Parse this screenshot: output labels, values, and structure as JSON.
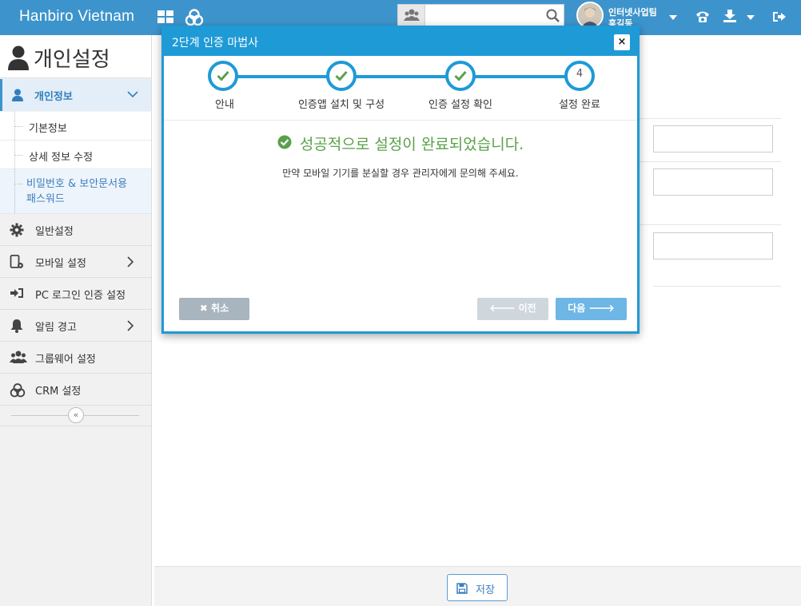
{
  "app": {
    "brand": "Hanbiro Vietnam"
  },
  "header": {
    "search_value": "",
    "user_team": "인터넷사업팀",
    "user_name": "홍길동"
  },
  "sidebar": {
    "page_title": "개인설정",
    "active_section": "개인정보",
    "sub_items": [
      {
        "label": "기본정보"
      },
      {
        "label": "상세 정보 수정"
      },
      {
        "label": "비밀번호 & 보안문서용 패스워드"
      }
    ],
    "nav_items": [
      {
        "label": "일반설정",
        "icon": "gear-icon"
      },
      {
        "label": "모바일 설정",
        "icon": "mobile-settings-icon"
      },
      {
        "label": "PC 로그인 인증 설정",
        "icon": "sign-in-icon"
      },
      {
        "label": "알림 경고",
        "icon": "bell-icon"
      },
      {
        "label": "그룹웨어 설정",
        "icon": "users-icon"
      },
      {
        "label": "CRM 설정",
        "icon": "crm-icon"
      }
    ]
  },
  "modal": {
    "title": "2단계 인증 마법사",
    "close": "×",
    "steps": [
      {
        "label": "안내",
        "done": true
      },
      {
        "label": "인증앱 설치 및 구성",
        "done": true
      },
      {
        "label": "인증 설정 확인",
        "done": true
      },
      {
        "label": "설정 완료",
        "done": false,
        "number": "4"
      }
    ],
    "success_message": "성공적으로 설정이 완료되었습니다.",
    "description": "만약 모바일 기기를 분실할 경우 관리자에게 문의해 주세요.",
    "cancel_label": "✖ 취소",
    "prev_label": "🡐 이전",
    "next_label": "다음 🡒"
  },
  "footer": {
    "save_label": "저장"
  },
  "colors": {
    "topbar": "#3d94cc",
    "modal_accent": "#1e9ad6",
    "success": "#5aa14a"
  }
}
